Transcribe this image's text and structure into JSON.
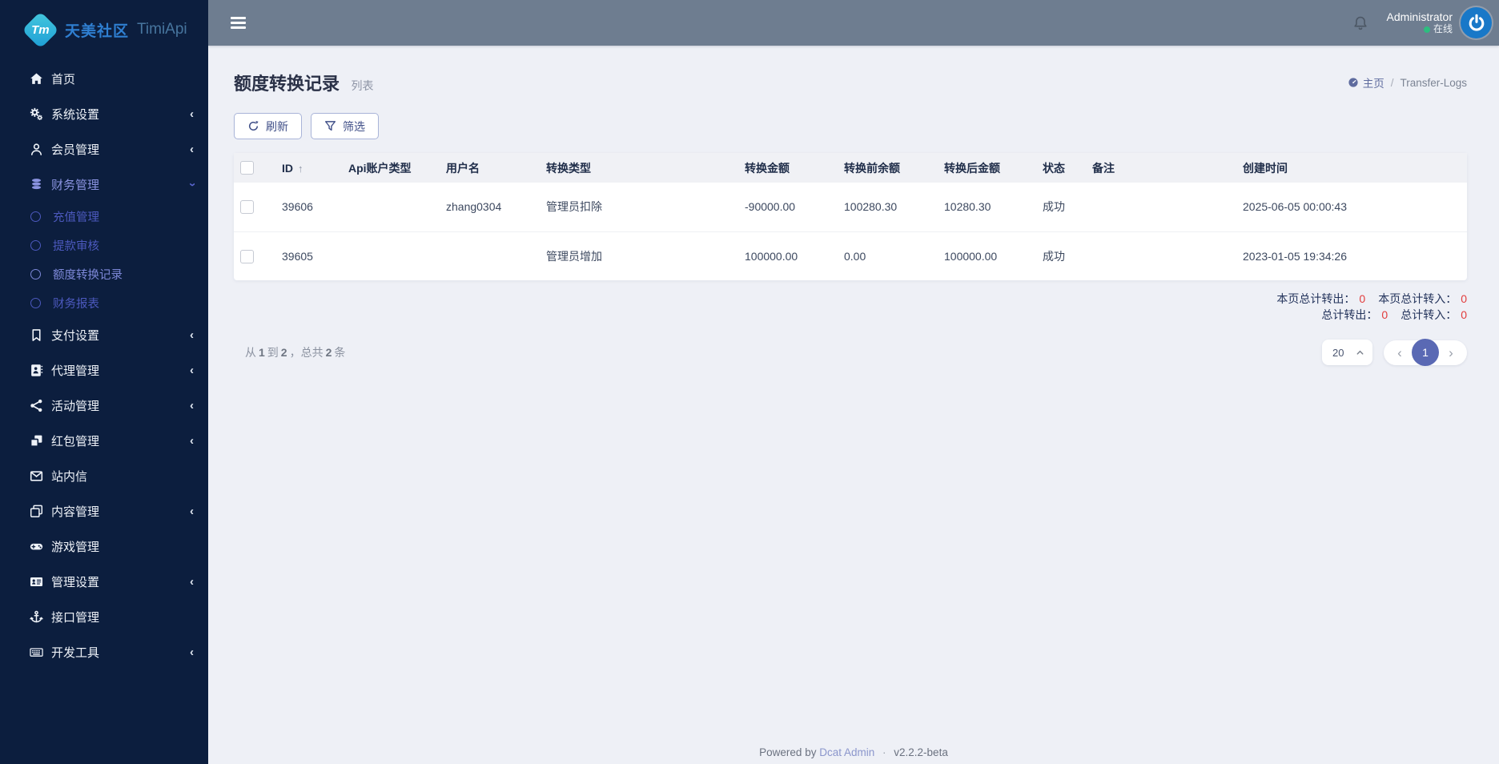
{
  "colors": {
    "sidebar_bg": "#0c1e3e",
    "header_bg": "#6e7d90",
    "content_bg": "#eef0f6",
    "accent_indigo": "#5a69b4",
    "active_menu_text": "#8a93e0",
    "submenu_text": "#4c59be",
    "summary_value_red": "#e23c3c",
    "brand_blue": "#2f7fd1",
    "logo_teal": "#2fb9d8",
    "avatar_blue": "#1878c8",
    "online_green": "#2dbd7f"
  },
  "icons": {
    "chevron_left": "‹",
    "chevron_right": "›",
    "sort_asc": "↑"
  },
  "sidebar": {
    "logo": {
      "badge": "Tm",
      "brand": "天美社区",
      "brand_en": "TimiApi"
    },
    "items": [
      {
        "label": "首页",
        "icon": "home-icon"
      },
      {
        "label": "系统设置",
        "icon": "gears-icon"
      },
      {
        "label": "会员管理",
        "icon": "user-icon"
      },
      {
        "label": "财务管理",
        "icon": "database-icon",
        "children": [
          {
            "label": "充值管理"
          },
          {
            "label": "提款审核"
          },
          {
            "label": "额度转换记录",
            "active": true
          },
          {
            "label": "财务报表"
          }
        ]
      },
      {
        "label": "支付设置",
        "icon": "bookmark-icon"
      },
      {
        "label": "代理管理",
        "icon": "address-book-icon"
      },
      {
        "label": "活动管理",
        "icon": "share-icon"
      },
      {
        "label": "红包管理",
        "icon": "cubes-icon"
      },
      {
        "label": "站内信",
        "icon": "envelope-icon"
      },
      {
        "label": "内容管理",
        "icon": "copy-icon"
      },
      {
        "label": "游戏管理",
        "icon": "gamepad-icon"
      },
      {
        "label": "管理设置",
        "icon": "id-card-icon"
      },
      {
        "label": "接口管理",
        "icon": "anchor-icon"
      },
      {
        "label": "开发工具",
        "icon": "keyboard-icon"
      }
    ]
  },
  "header": {
    "user": "Administrator",
    "status": "在线"
  },
  "page": {
    "title": "额度转换记录",
    "subtitle": "列表",
    "breadcrumb_home": "主页",
    "breadcrumb_sep": "/",
    "breadcrumb_current": "Transfer-Logs"
  },
  "toolbar": {
    "refresh": "刷新",
    "filter": "筛选"
  },
  "table": {
    "columns": [
      "ID",
      "Api账户类型",
      "用户名",
      "转换类型",
      "转换金额",
      "转换前余额",
      "转换后金额",
      "状态",
      "备注",
      "创建时间"
    ],
    "rows": [
      {
        "id": "39606",
        "api_type": "",
        "username": "zhang0304",
        "type": "管理员扣除",
        "amount": "-90000.00",
        "before": "100280.30",
        "after": "10280.30",
        "status": "成功",
        "remark": "",
        "created": "2025-06-05 00:00:43"
      },
      {
        "id": "39605",
        "api_type": "",
        "username": "",
        "type": "管理员增加",
        "amount": "100000.00",
        "before": "0.00",
        "after": "100000.00",
        "status": "成功",
        "remark": "",
        "created": "2023-01-05 19:34:26"
      }
    ]
  },
  "summary": {
    "page_out_label": "本页总计转出：",
    "page_out": "0",
    "page_in_label": "本页总计转入：",
    "page_in": "0",
    "total_out_label": "总计转出：",
    "total_out": "0",
    "total_in_label": "总计转入：",
    "total_in": "0"
  },
  "pagination": {
    "from_label": "从",
    "from": "1",
    "to_label": "到",
    "to": "2",
    "comma": "，",
    "total_label": "总共",
    "total": "2",
    "unit": "条",
    "per_page": "20",
    "current": "1"
  },
  "footer": {
    "powered": "Powered by",
    "link": "Dcat Admin",
    "sep": "·",
    "version": "v2.2.2-beta"
  }
}
